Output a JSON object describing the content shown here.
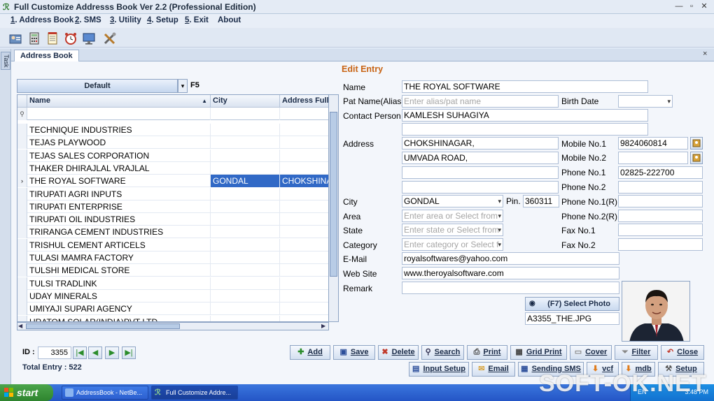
{
  "window": {
    "title": "Full Customize Addresss Book Ver 2.2 (Professional Edition)",
    "controls": [
      "—",
      "▫",
      "✕"
    ]
  },
  "menu": [
    {
      "key": "1",
      "label": ". Address Book"
    },
    {
      "key": "2",
      "label": ". SMS"
    },
    {
      "key": "3",
      "label": ". Utility"
    },
    {
      "key": "4",
      "label": ". Setup"
    },
    {
      "key": "5",
      "label": ". Exit"
    },
    {
      "key": "",
      "label": "About"
    }
  ],
  "toolbar_icons": [
    "contacts-icon",
    "calculator-icon",
    "notepad-icon",
    "alarm-clock-icon",
    "monitor-icon",
    "tools-icon"
  ],
  "task_strip": {
    "label": "Task"
  },
  "tab": {
    "label": "Address Book",
    "close": "×"
  },
  "edit": {
    "title": "Edit Entry"
  },
  "group": {
    "selected": "Default",
    "shortcut": "F5"
  },
  "grid": {
    "columns": [
      "Name",
      "City",
      "Address Full"
    ],
    "filter_icon": "filter-icon",
    "rows": [
      {
        "name": "TECHNIQUE INDUSTRIES",
        "city": "",
        "address": ""
      },
      {
        "name": "TEJAS PLAYWOOD",
        "city": "",
        "address": ""
      },
      {
        "name": "TEJAS SALES CORPORATION",
        "city": "",
        "address": ""
      },
      {
        "name": "THAKER DHIRAJLAL VRAJLAL",
        "city": "",
        "address": ""
      },
      {
        "name": "THE ROYAL SOFTWARE",
        "city": "GONDAL",
        "address": "CHOKSHINA",
        "selected": true
      },
      {
        "name": "TIRUPATI AGRI INPUTS",
        "city": "",
        "address": ""
      },
      {
        "name": "TIRUPATI ENTERPRISE",
        "city": "",
        "address": ""
      },
      {
        "name": "TIRUPATI OIL INDUSTRIES",
        "city": "",
        "address": ""
      },
      {
        "name": "TRIRANGA CEMENT INDUSTRIES",
        "city": "",
        "address": ""
      },
      {
        "name": "TRISHUL CEMENT ARTICELS",
        "city": "",
        "address": ""
      },
      {
        "name": "TULASI MAMRA FACTORY",
        "city": "",
        "address": ""
      },
      {
        "name": "TULSHI MEDICAL STORE",
        "city": "",
        "address": ""
      },
      {
        "name": "TULSI TRADLINK",
        "city": "",
        "address": ""
      },
      {
        "name": "UDAY MINERALS",
        "city": "",
        "address": ""
      },
      {
        "name": "UMIYAJI SUPARI AGENCY",
        "city": "",
        "address": ""
      },
      {
        "name": "URATOM SOLAR(INDIA)PVT LTD",
        "city": "",
        "address": ""
      }
    ]
  },
  "form": {
    "name_label": "Name",
    "name": "THE ROYAL SOFTWARE",
    "pat_label": "Pat Name(Alias)",
    "pat_placeholder": "Enter alias/pat name",
    "birth_label": "Birth Date",
    "birth": "",
    "contact_label": "Contact Person",
    "contact": "KAMLESH SUHAGIYA",
    "contact2": "",
    "address_label": "Address",
    "address1": "CHOKSHINAGAR,",
    "address2": "UMVADA ROAD,",
    "address3": "",
    "address4": "",
    "city_label": "City",
    "city": "GONDAL",
    "pin_label": "Pin.",
    "pin": "360311",
    "area_label": "Area",
    "area_placeholder": "Enter area or Select from",
    "state_label": "State",
    "state_placeholder": "Enter state or Select from",
    "category_label": "Category",
    "category_placeholder": "Enter category or Select f",
    "email_label": "E-Mail",
    "email": "royalsoftwares@yahoo.com",
    "web_label": "Web Site",
    "web": "www.theroyalsoftware.com",
    "remark_label": "Remark",
    "remark": "",
    "mobile1_label": "Mobile No.1",
    "mobile1": "9824060814",
    "mobile2_label": "Mobile No.2",
    "mobile2": "",
    "phone1_label": "Phone No.1",
    "phone1": "02825-222700",
    "phone2_label": "Phone No.2",
    "phone2": "",
    "phone1r_label": "Phone No.1(R)",
    "phone1r": "",
    "phone2r_label": "Phone No.2(R)",
    "phone2r": "",
    "fax1_label": "Fax No.1",
    "fax1": "",
    "fax2_label": "Fax No.2",
    "fax2": "",
    "select_photo_label": "(F7) Select Photo",
    "photo_file": "A3355_THE.JPG"
  },
  "footer": {
    "id_label": "ID :",
    "id_value": "3355",
    "total_label": "Total Entry : 522"
  },
  "buttons_row1": [
    {
      "label": "Add",
      "icon": "add-icon"
    },
    {
      "label": "Save",
      "icon": "save-icon"
    },
    {
      "label": "Delete",
      "icon": "delete-icon"
    },
    {
      "label": "Search",
      "icon": "search-icon"
    },
    {
      "label": "Print",
      "icon": "print-icon"
    },
    {
      "label": "Grid Print",
      "icon": "grid-print-icon"
    },
    {
      "label": "Cover",
      "icon": "cover-icon"
    },
    {
      "label": "Filter",
      "icon": "filter-icon"
    },
    {
      "label": "Close",
      "icon": "close-icon"
    }
  ],
  "buttons_row2": [
    {
      "label": "Input Setup",
      "icon": "input-setup-icon"
    },
    {
      "label": "Email",
      "icon": "email-icon"
    },
    {
      "label": "Sending SMS",
      "icon": "sms-icon"
    },
    {
      "label": "vcf",
      "icon": "vcf-icon"
    },
    {
      "label": "mdb",
      "icon": "mdb-icon"
    },
    {
      "label": "Setup",
      "icon": "setup-icon"
    }
  ],
  "taskbar": {
    "start": "start",
    "items": [
      "AddressBook - NetBe...",
      "Full Customize Addre..."
    ],
    "lang": "EN",
    "clock": "3:48 PM"
  },
  "watermark": "SOFT-OK.NET"
}
